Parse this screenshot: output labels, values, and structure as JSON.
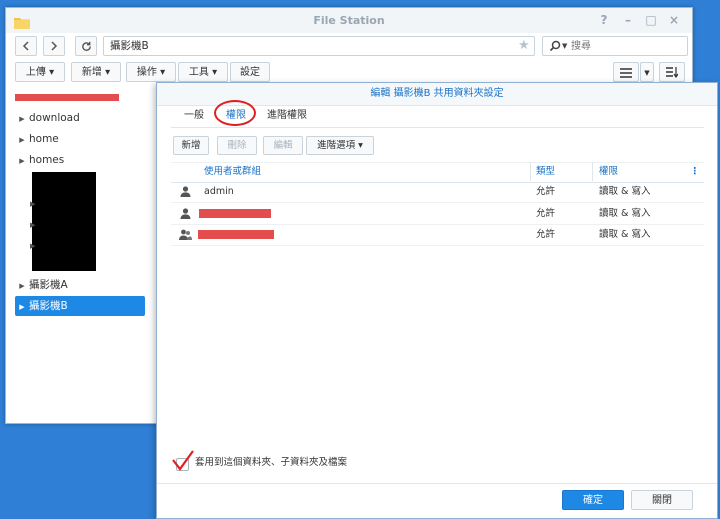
{
  "window": {
    "title": "File Station",
    "path": "攝影機B",
    "search_placeholder": "搜尋"
  },
  "toolbar": {
    "upload": "上傳 ▾",
    "create": "新增 ▾",
    "action": "操作 ▾",
    "tools": "工具 ▾",
    "settings": "設定"
  },
  "sidebar": {
    "items": [
      {
        "label": "download"
      },
      {
        "label": "home"
      },
      {
        "label": "homes"
      },
      {
        "label": "攝影機A"
      },
      {
        "label": "攝影機B"
      }
    ]
  },
  "dialog": {
    "title": "編輯 攝影機B 共用資料夾設定",
    "tabs": [
      "一般",
      "權限",
      "進階權限"
    ],
    "buttons": {
      "add": "新增",
      "delete": "刪除",
      "edit": "編輯",
      "advanced": "進階選項 ▾"
    },
    "columns": {
      "user": "使用者或群組",
      "type": "類型",
      "permission": "權限"
    },
    "rows": [
      {
        "user": "admin",
        "type": "允許",
        "permission": "讀取 & 寫入"
      },
      {
        "user": "",
        "type": "允許",
        "permission": "讀取 & 寫入"
      },
      {
        "user": "",
        "type": "允許",
        "permission": "讀取 & 寫入"
      }
    ],
    "apply_label": "套用到這個資料夾、子資料夾及檔案",
    "ok": "確定",
    "close": "關閉"
  },
  "colors": {
    "accent": "#1e88e5",
    "annotation": "#e02020"
  }
}
